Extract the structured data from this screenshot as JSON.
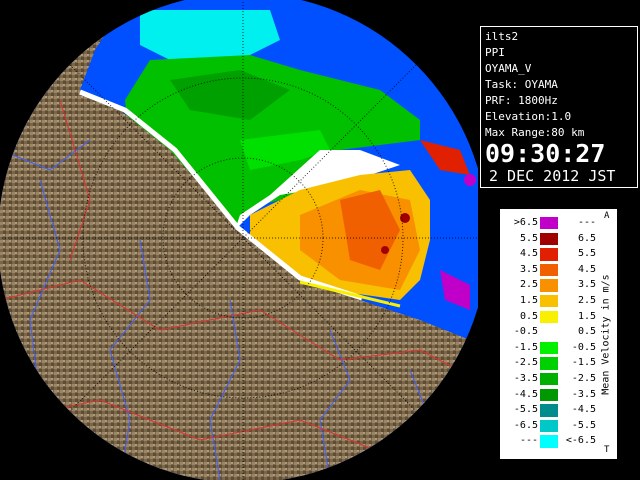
{
  "info": {
    "site": "ilts2",
    "mode": "PPI",
    "product": "OYAMA_V",
    "task": "Task: OYAMA",
    "prf": "PRF: 1800Hz",
    "elevation": "Elevation:1.0",
    "max_range": "Max Range:80 km",
    "time": "09:30:27",
    "date": "2 DEC 2012 JST"
  },
  "legend": {
    "title": "Mean Velocity in m/s",
    "top_marker": "A",
    "bottom_marker": "T",
    "rows": [
      {
        "lo": ">6.5",
        "hi": "---",
        "color": "#c000c8"
      },
      {
        "lo": "5.5",
        "hi": "6.5",
        "color": "#a00000"
      },
      {
        "lo": "4.5",
        "hi": "5.5",
        "color": "#e02000"
      },
      {
        "lo": "3.5",
        "hi": "4.5",
        "color": "#f06000"
      },
      {
        "lo": "2.5",
        "hi": "3.5",
        "color": "#f89000"
      },
      {
        "lo": "1.5",
        "hi": "2.5",
        "color": "#f8c000"
      },
      {
        "lo": "0.5",
        "hi": "1.5",
        "color": "#f8f000"
      },
      {
        "lo": "-0.5",
        "hi": "0.5",
        "color": "#ffffff"
      },
      {
        "lo": "-1.5",
        "hi": "-0.5",
        "color": "#00f000"
      },
      {
        "lo": "-2.5",
        "hi": "-1.5",
        "color": "#00d000"
      },
      {
        "lo": "-3.5",
        "hi": "-2.5",
        "color": "#00b000"
      },
      {
        "lo": "-4.5",
        "hi": "-3.5",
        "color": "#009800"
      },
      {
        "lo": "-5.5",
        "hi": "-4.5",
        "color": "#008c8c"
      },
      {
        "lo": "-6.5",
        "hi": "-5.5",
        "color": "#00c8c8"
      },
      {
        "lo": "---",
        "hi": "<-6.5",
        "color": "#00ffff"
      }
    ]
  },
  "colors": {
    "range_blue": "#0050ff",
    "terrain": "#8a7558",
    "rivers": "#4060ff",
    "boundaries": "#e03030"
  }
}
